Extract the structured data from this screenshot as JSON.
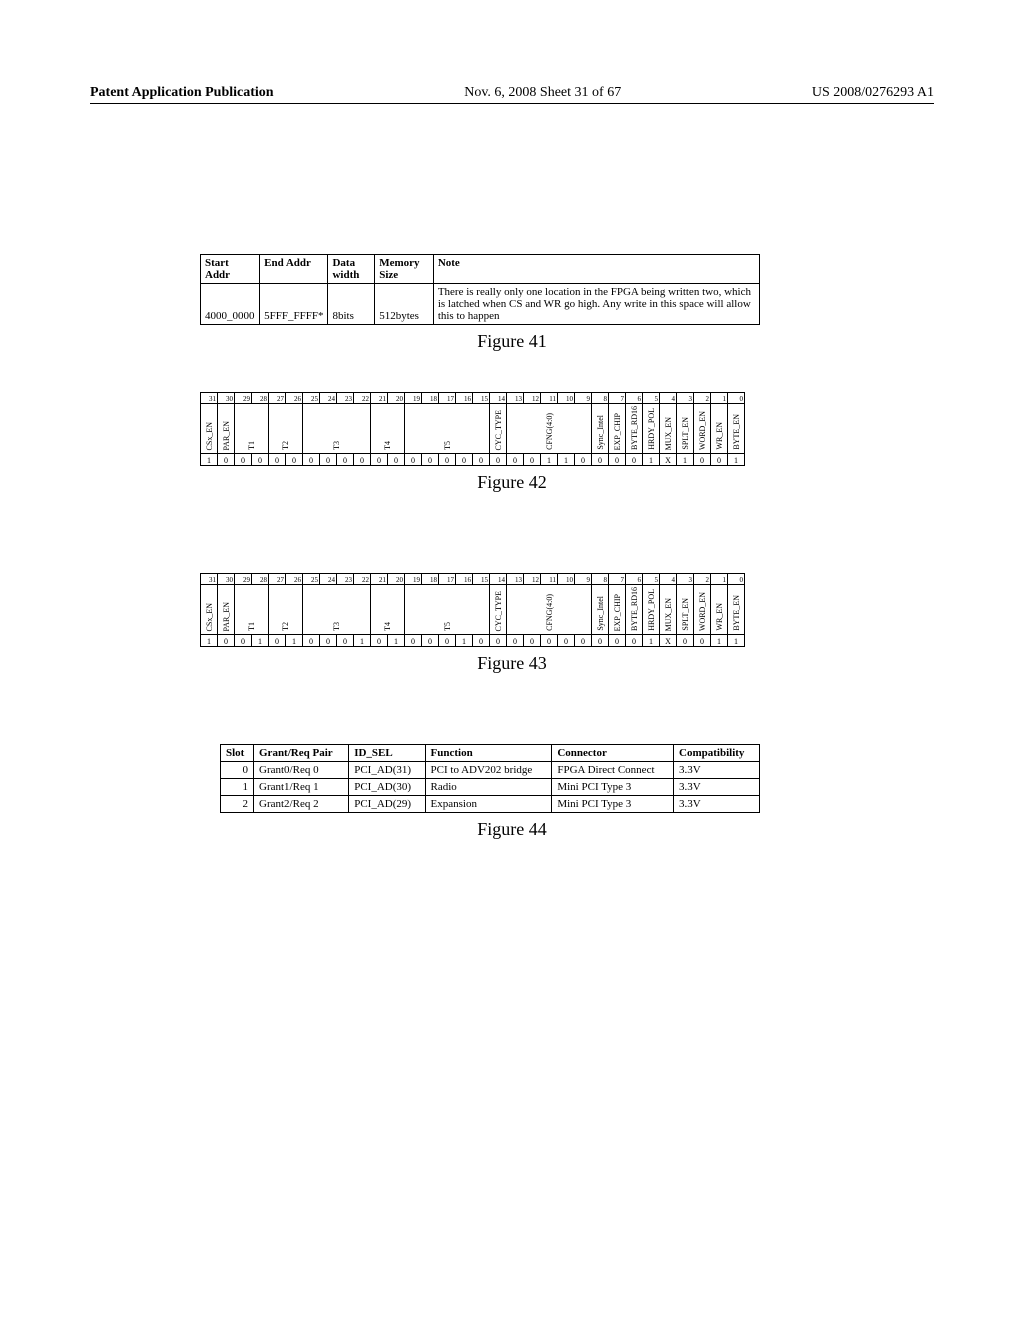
{
  "header": {
    "left": "Patent Application Publication",
    "mid": "Nov. 6, 2008  Sheet 31 of 67",
    "right": "US 2008/0276293 A1"
  },
  "fig41": {
    "headers": [
      "Start Addr",
      "End Addr",
      "Data width",
      "Memory Size",
      "Note"
    ],
    "row": {
      "start": "4000_0000",
      "end": "5FFF_FFFF*",
      "width": "8bits",
      "size": "512bytes",
      "note": "There is really only one location in the FPGA being written two, which is latched when CS and WR go high.  Any write in this space will allow this to happen"
    },
    "caption": "Figure 41"
  },
  "fig42": {
    "nums": [
      "31",
      "30",
      "29",
      "28",
      "27",
      "26",
      "25",
      "24",
      "23",
      "22",
      "21",
      "20",
      "19",
      "18",
      "17",
      "16",
      "15",
      "14",
      "13",
      "12",
      "11",
      "10",
      "9",
      "8",
      "7",
      "6",
      "5",
      "4",
      "3",
      "2",
      "1",
      "0"
    ],
    "labels": {
      "b31": "CSx_EN",
      "b30": "PAR_EN",
      "b29": "T1",
      "b27": "T2",
      "b25": "T3",
      "b21": "T4",
      "b19": "T5",
      "b14": "CYC_TYPE",
      "b13": "CFNG(4:0)",
      "b8": "Sync_Intel",
      "b7": "EXP_CHIP",
      "b6": "BYTE_RD16",
      "b5": "HRDY_POL",
      "b4": "MUX_EN",
      "b3": "SPLT_EN",
      "b2": "WORD_EN",
      "b1": "WR_EN",
      "b0": "BYTE_EN"
    },
    "vals": [
      "1",
      "0",
      "0",
      "0",
      "0",
      "0",
      "0",
      "0",
      "0",
      "0",
      "0",
      "0",
      "0",
      "0",
      "0",
      "0",
      "0",
      "0",
      "0",
      "0",
      "1",
      "1",
      "0",
      "0",
      "0",
      "0",
      "1",
      "X",
      "1",
      "0",
      "0",
      "1"
    ],
    "caption": "Figure 42"
  },
  "fig43": {
    "nums": [
      "31",
      "30",
      "29",
      "28",
      "27",
      "26",
      "25",
      "24",
      "23",
      "22",
      "21",
      "20",
      "19",
      "18",
      "17",
      "16",
      "15",
      "14",
      "13",
      "12",
      "11",
      "10",
      "9",
      "8",
      "7",
      "6",
      "5",
      "4",
      "3",
      "2",
      "1",
      "0"
    ],
    "labels": {
      "b31": "CSx_EN",
      "b30": "PAR_EN",
      "b29": "T1",
      "b27": "T2",
      "b25": "T3",
      "b21": "T4",
      "b19": "T5",
      "b14": "CYC_TYPE",
      "b13": "CFNG(4:0)",
      "b8": "Sync_Intel",
      "b7": "EXP_CHIP",
      "b6": "BYTE_RD16",
      "b5": "HRDY_POL",
      "b4": "MUX_EN",
      "b3": "SPLT_EN",
      "b2": "WORD_EN",
      "b1": "WR_EN",
      "b0": "BYTE_EN"
    },
    "vals": [
      "1",
      "0",
      "0",
      "1",
      "0",
      "1",
      "0",
      "0",
      "0",
      "1",
      "0",
      "1",
      "0",
      "0",
      "0",
      "1",
      "0",
      "0",
      "0",
      "0",
      "0",
      "0",
      "0",
      "0",
      "0",
      "0",
      "1",
      "X",
      "0",
      "0",
      "1",
      "1"
    ],
    "caption": "Figure 43"
  },
  "fig44": {
    "headers": [
      "Slot",
      "Grant/Req Pair",
      "ID_SEL",
      "Function",
      "Connector",
      "Compatibility"
    ],
    "rows": [
      {
        "slot": "0",
        "pair": "Grant0/Req 0",
        "id": "PCI_AD(31)",
        "func": "PCI to ADV202 bridge",
        "conn": "FPGA Direct Connect",
        "compat": "3.3V"
      },
      {
        "slot": "1",
        "pair": "Grant1/Req 1",
        "id": "PCI_AD(30)",
        "func": "Radio",
        "conn": "Mini PCI Type 3",
        "compat": "3.3V"
      },
      {
        "slot": "2",
        "pair": "Grant2/Req 2",
        "id": "PCI_AD(29)",
        "func": "Expansion",
        "conn": "Mini PCI Type 3",
        "compat": "3.3V"
      }
    ],
    "caption": "Figure 44"
  }
}
